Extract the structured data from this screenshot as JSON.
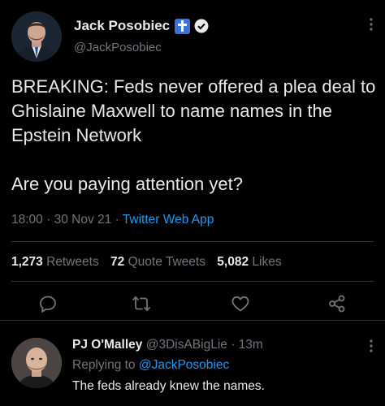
{
  "tweet": {
    "author": {
      "display_name": "Jack Posobiec",
      "handle": "@JackPosobiec",
      "badges": [
        "cross-icon",
        "verified-icon"
      ]
    },
    "text": "BREAKING: Feds never offered a plea deal to Ghislaine Maxwell to name names in the Epstein Network\n\nAre you paying attention yet?",
    "time": "18:00",
    "date": "30 Nov 21",
    "separator": "·",
    "source": "Twitter Web App",
    "stats": [
      {
        "count": "1,273",
        "label": "Retweets"
      },
      {
        "count": "72",
        "label": "Quote Tweets"
      },
      {
        "count": "5,082",
        "label": "Likes"
      }
    ],
    "actions": [
      "reply-icon",
      "retweet-icon",
      "like-icon",
      "share-icon"
    ]
  },
  "reply": {
    "author": {
      "display_name": "PJ O'Malley",
      "handle": "@3DisABigLie",
      "separator": "·",
      "time": "13m"
    },
    "replying_to_label": "Replying to",
    "replying_to_handle": "@JackPosobiec",
    "text": "The feds already knew the names."
  },
  "colors": {
    "background": "#000000",
    "text": "#e7e9ea",
    "muted": "#71767b",
    "accent": "#1d9bf0",
    "divider": "#2f3336"
  }
}
